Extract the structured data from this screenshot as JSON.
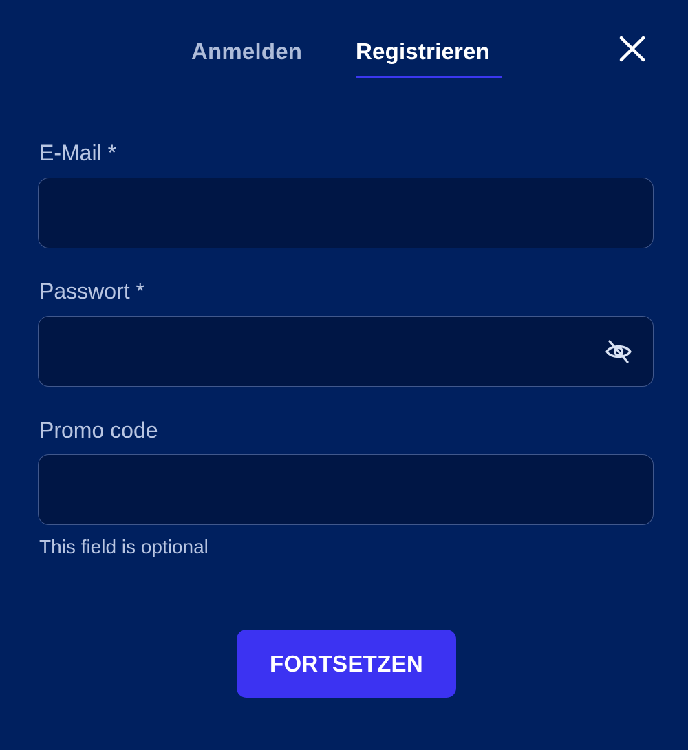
{
  "tabs": {
    "login_label": "Anmelden",
    "register_label": "Registrieren",
    "active": "register"
  },
  "form": {
    "email": {
      "label": "E-Mail *",
      "value": "",
      "placeholder": ""
    },
    "password": {
      "label": "Passwort *",
      "value": "",
      "placeholder": ""
    },
    "promo": {
      "label": "Promo code",
      "value": "",
      "placeholder": "",
      "hint": "This field is optional"
    }
  },
  "submit_label": "FORTSETZEN",
  "icons": {
    "close": "close-icon",
    "password_toggle": "eye-off-icon"
  },
  "colors": {
    "background": "#00205f",
    "input_background": "#001645",
    "accent": "#3c33f2",
    "label": "#b9c6e2",
    "inactive_tab": "#aebcd9"
  }
}
